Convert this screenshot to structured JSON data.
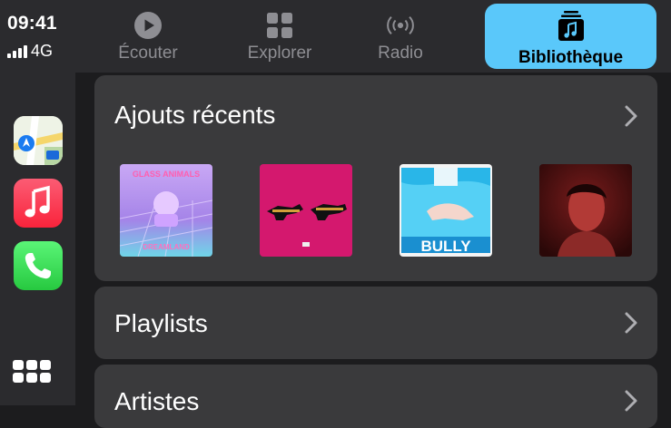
{
  "status": {
    "time": "09:41",
    "network": "4G"
  },
  "dock": {
    "apps": [
      {
        "name": "maps",
        "icon": "maps-app-icon"
      },
      {
        "name": "music",
        "icon": "music-app-icon"
      },
      {
        "name": "phone",
        "icon": "phone-app-icon"
      }
    ],
    "home_icon": "app-grid-icon"
  },
  "tabs": [
    {
      "label": "Écouter",
      "icon": "play-circle-icon",
      "selected": false
    },
    {
      "label": "Explorer",
      "icon": "grid-squares-icon",
      "selected": false
    },
    {
      "label": "Radio",
      "icon": "broadcast-icon",
      "selected": false
    },
    {
      "label": "Bibliothèque",
      "icon": "library-music-icon",
      "selected": true
    }
  ],
  "recent": {
    "title": "Ajouts récents",
    "albums": [
      {
        "cover_text": "GLASS ANIMALS",
        "cover_subtext": "DREAMLAND"
      },
      {
        "cover_text": ""
      },
      {
        "cover_text": "BULLY"
      },
      {
        "cover_text": ""
      }
    ]
  },
  "sections": [
    {
      "title": "Playlists"
    },
    {
      "title": "Artistes"
    }
  ],
  "colors": {
    "accent": "#5ac8fa",
    "card": "#3a3a3c",
    "background": "#1c1c1e",
    "bar": "#2b2b2e"
  }
}
